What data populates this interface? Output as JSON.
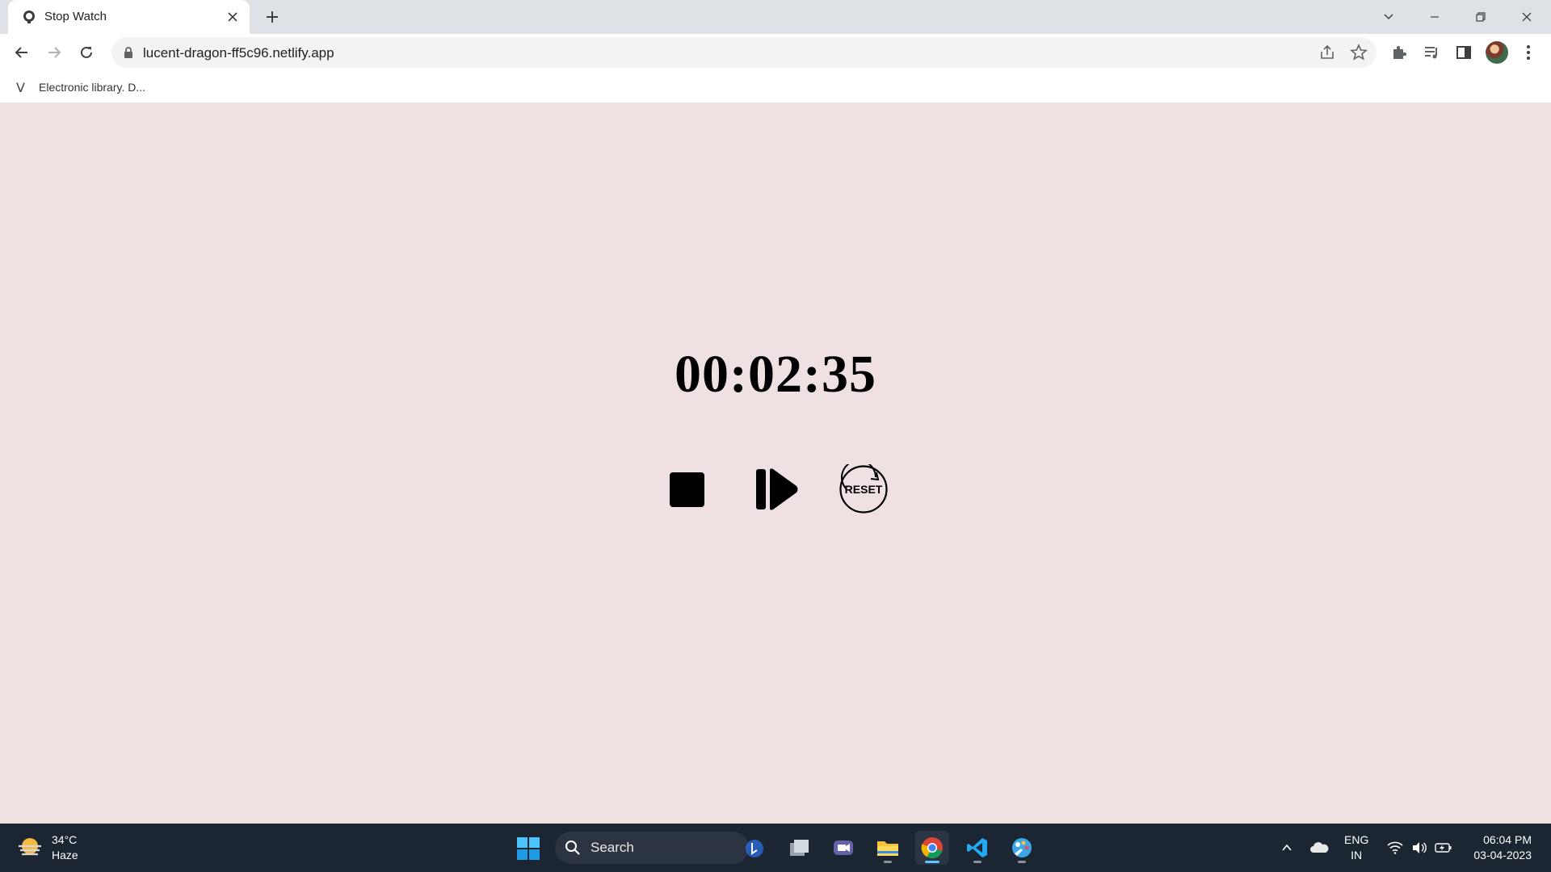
{
  "browser": {
    "tab_title": "Stop Watch",
    "url": "lucent-dragon-ff5c96.netlify.app",
    "bookmarks": [
      {
        "label": "Electronic library. D..."
      }
    ]
  },
  "stopwatch": {
    "time": "00:02:35",
    "buttons": {
      "stop_icon": "stop-icon",
      "resume_icon": "play-pause-icon",
      "reset_label": "RESET"
    }
  },
  "taskbar": {
    "weather": {
      "temperature": "34°C",
      "condition": "Haze"
    },
    "search_label": "Search",
    "language": {
      "line1": "ENG",
      "line2": "IN"
    },
    "clock": {
      "time": "06:04 PM",
      "date": "03-04-2023"
    }
  },
  "colors": {
    "page_background": "#efe1e1",
    "taskbar": "#1c2532",
    "tab_strip": "#dee1e6"
  }
}
